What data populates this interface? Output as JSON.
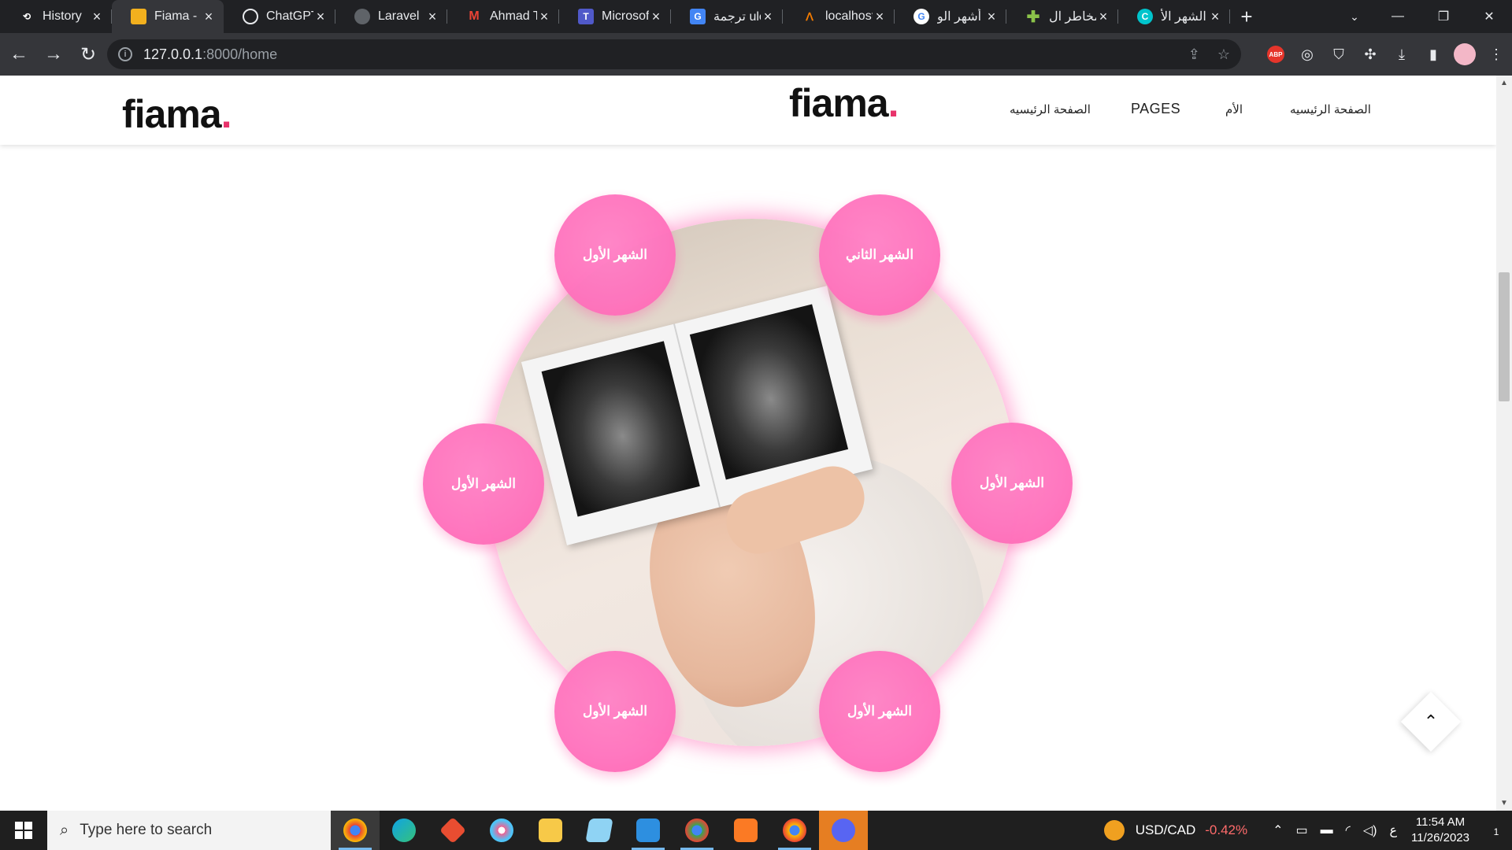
{
  "browser": {
    "tabs": [
      {
        "title": "History",
        "icon": "history-icon",
        "active": false
      },
      {
        "title": "Fiama - I",
        "icon": "fiama-favicon",
        "active": true
      },
      {
        "title": "ChatGPT",
        "icon": "chatgpt-icon",
        "active": false
      },
      {
        "title": "Laravel",
        "icon": "globe-icon",
        "active": false
      },
      {
        "title": "Ahmad T",
        "icon": "gmail-icon",
        "active": false
      },
      {
        "title": "Microsof",
        "icon": "teams-icon",
        "active": false
      },
      {
        "title": "ترجمة ule",
        "icon": "google-translate-icon",
        "active": false
      },
      {
        "title": "localhost",
        "icon": "xampp-icon",
        "active": false
      },
      {
        "title": "أشهر الو",
        "icon": "google-icon",
        "active": false
      },
      {
        "title": "مخاطر ال",
        "icon": "health-cross-icon",
        "active": false
      },
      {
        "title": "الشهر الأ",
        "icon": "canva-icon",
        "active": false
      }
    ],
    "close_glyph": "×",
    "new_tab_glyph": "+",
    "url_host": "127.0.0.1",
    "url_path": ":8000/home",
    "extension_abp": "ABP"
  },
  "site": {
    "logo_text": "fiama",
    "logo_dot": ".",
    "menu": {
      "home_1": "الصفحة الرئيسيه",
      "pages": "PAGES",
      "mother": "الأم",
      "home_2": "الصفحة الرئيسيه"
    },
    "bubbles": {
      "top_left": "الشهر الأول",
      "top_right": "الشهر الثاني",
      "mid_left": "الشهر الأول",
      "mid_right": "الشهر الأول",
      "bottom_left": "الشهر الأول",
      "bottom_right": "الشهر الأول"
    },
    "accent_pink": "#ff73bd",
    "brand_dot_color": "#e8336b"
  },
  "taskbar": {
    "search_placeholder": "Type here to search",
    "stock_label": "USD/CAD",
    "stock_change": "-0.42%",
    "lang": "ع",
    "time": "11:54 AM",
    "date": "11/26/2023",
    "notification_count": "1"
  }
}
